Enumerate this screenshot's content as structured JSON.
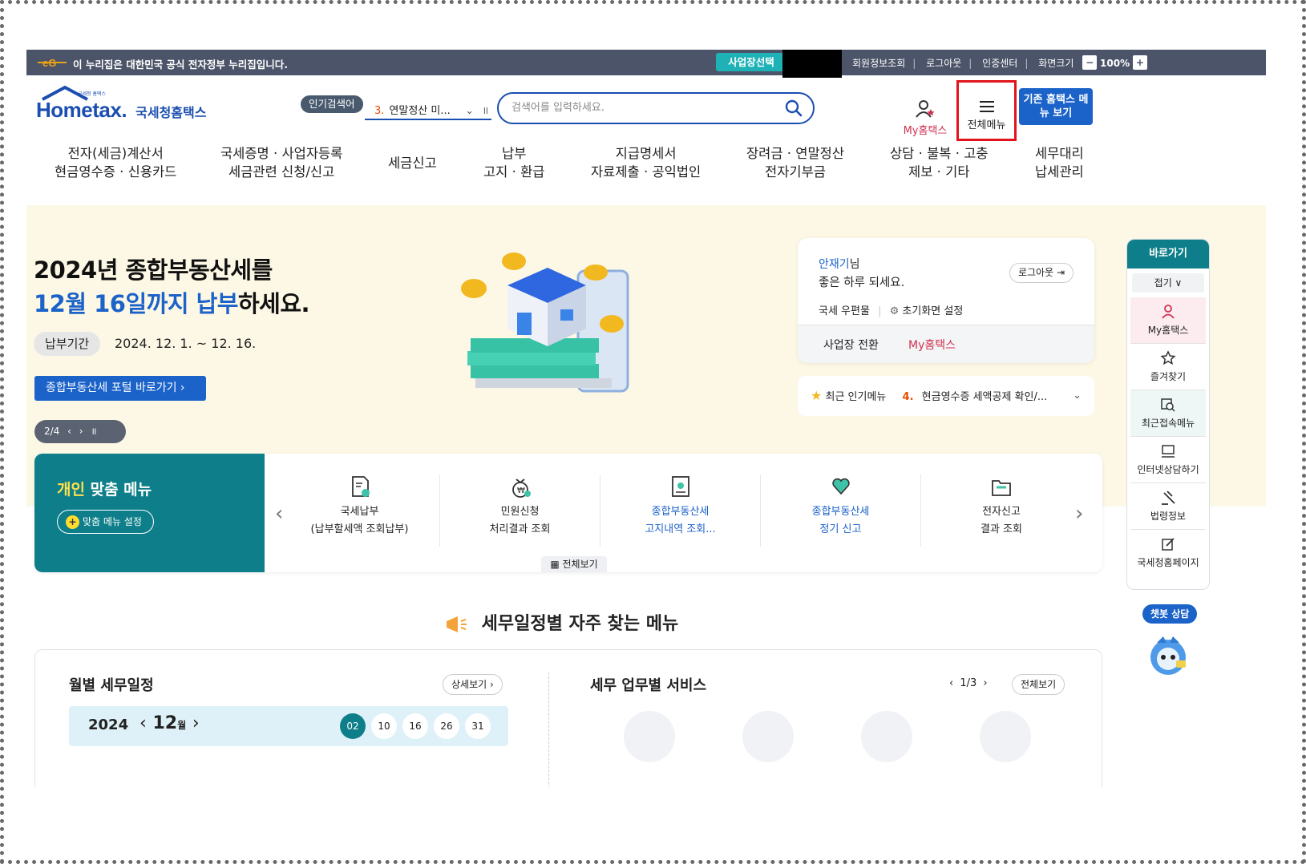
{
  "topbar": {
    "gov_notice": "이 누리집은 대한민국 공식 전자정부 누리집입니다.",
    "business_select": "사업장선택",
    "links": [
      "회원정보조회",
      "로그아웃",
      "인증센터",
      "화면크기"
    ],
    "zoom": "100%",
    "zoom_minus": "−",
    "zoom_plus": "+"
  },
  "brand": {
    "logo_small": "국세청 홈택스",
    "name": "Hometax.",
    "sub": "국세청홈택스"
  },
  "popular": {
    "badge": "인기검색어",
    "rank": "3.",
    "term": "연말정산 미..."
  },
  "search": {
    "placeholder": "검색어를 입력하세요."
  },
  "header": {
    "my_hometax": "My홈택스",
    "all_menu": "전체메뉴",
    "old_menu": "기존 홈택스 메뉴 보기"
  },
  "nav": [
    [
      "전자(세금)계산서",
      "현금영수증 · 신용카드"
    ],
    [
      "국세증명 · 사업자등록",
      "세금관련 신청/신고"
    ],
    [
      "세금신고"
    ],
    [
      "납부",
      "고지 · 환급"
    ],
    [
      "지급명세서",
      "자료제출 · 공익법인"
    ],
    [
      "장려금 · 연말정산",
      "전자기부금"
    ],
    [
      "상담 · 불복 · 고충",
      "제보 · 기타"
    ],
    [
      "세무대리",
      "납세관리"
    ]
  ],
  "hero": {
    "title_line1": "2024년 종합부동산세를",
    "title_line2_blue": "12월 16일까지 납부",
    "title_line2_rest": "하세요.",
    "period_label": "납부기간",
    "period_value": "2024. 12. 1. ~ 12. 16.",
    "portal_button": "종합부동산세 포털 바로가기  ›",
    "slide": "2/4  ‹  ›  ॥"
  },
  "user": {
    "name": "안재기",
    "suffix": "님",
    "greeting": "좋은 하루 되세요.",
    "logout": "로그아웃",
    "postbox": "국세 우편물",
    "init_setting": "초기화면 설정",
    "switch_business": "사업장 전환",
    "my_hometax": "My홈택스"
  },
  "popular_menu": {
    "label": "최근 인기메뉴",
    "rank": "4.",
    "item": "현금영수증 세액공제 확인/..."
  },
  "quick": {
    "title": "바로가기",
    "fold": "접기 ∨",
    "items": [
      "My홈택스",
      "즐겨찾기",
      "최근접속메뉴",
      "인터넷상담하기",
      "법령정보",
      "국세청홈페이지"
    ]
  },
  "chatbot": {
    "label": "챗봇 상담"
  },
  "personal_menu": {
    "title_yellow": "개인",
    "title_rest": " 맞춤 메뉴",
    "setting": "맞춤 메뉴 설정",
    "all_view": "전체보기",
    "items": [
      {
        "line1": "국세납부",
        "line2": "(납부할세액 조회납부)"
      },
      {
        "line1": "민원신청",
        "line2": "처리결과 조회"
      },
      {
        "line1": "종합부동산세",
        "line2": "고지내역 조회..."
      },
      {
        "line1": "종합부동산세",
        "line2": "정기 신고"
      },
      {
        "line1": "전자신고",
        "line2": "결과 조회"
      }
    ]
  },
  "schedule": {
    "heading": "세무일정별 자주 찾는 메뉴",
    "monthly_title": "월별 세무일정",
    "detail": "상세보기 ›",
    "year": "2024",
    "month": "12",
    "month_unit": "월",
    "days": [
      "02",
      "10",
      "16",
      "26",
      "31"
    ],
    "service_title": "세무 업무별 서비스",
    "page": "‹ 1/3 ›",
    "all_view": "전체보기"
  },
  "colors": {
    "accent": "#1b62c9",
    "teal": "#0e7f8a",
    "topbar": "#4b5468",
    "highlight": "#e1131b",
    "hero_bg": "#fdf8e5"
  }
}
